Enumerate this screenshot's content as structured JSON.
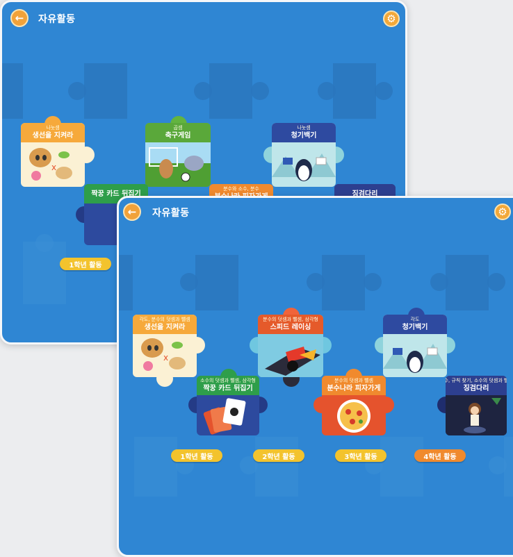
{
  "back_window": {
    "title": "자유활동",
    "puzzles": [
      {
        "sub": "나눗셈",
        "name": "생선을 지켜라"
      },
      {
        "sub": "곱셈",
        "name": "축구게임"
      },
      {
        "sub": "나눗셈",
        "name": "청기백기"
      },
      {
        "sub": "",
        "name": "짝꿍 카드 뒤집기"
      },
      {
        "sub": "분수와 소수, 분수",
        "name": "분수나라 피자가게"
      },
      {
        "sub": "",
        "name": "징검다리"
      }
    ],
    "grade_buttons": [
      "1학년 활동"
    ]
  },
  "front_window": {
    "title": "자유활동",
    "puzzles": [
      {
        "sub": "각도, 분수의 덧셈과 뺄셈",
        "name": "생선을 지켜라"
      },
      {
        "sub": "분수의 덧셈과 뺄셈, 삼각형",
        "name": "스피드 레이싱"
      },
      {
        "sub": "각도",
        "name": "청기백기"
      },
      {
        "sub": "소수의 덧셈과 뺄셈, 삼각형",
        "name": "짝꿍 카드 뒤집기"
      },
      {
        "sub": "분수의 덧셈과 뺄셈",
        "name": "분수나라 피자가게"
      },
      {
        "sub": "소수, 규칙 찾기, 소수의 덧셈과 뺄셈",
        "name": "징검다리"
      }
    ],
    "grade_buttons": [
      "1학년 활동",
      "2학년 활동",
      "3학년 활동",
      "4학년 활동"
    ]
  },
  "colors": {
    "background_blue": "#2f86d3",
    "orange": "#f08a2e",
    "yellow": "#f3c32d",
    "green": "#4caf50",
    "navy": "#273d8f",
    "red": "#e5532d",
    "teal": "#2fa6c9"
  },
  "icons": {
    "back": "arrow-left-icon",
    "settings": "gear-icon"
  }
}
